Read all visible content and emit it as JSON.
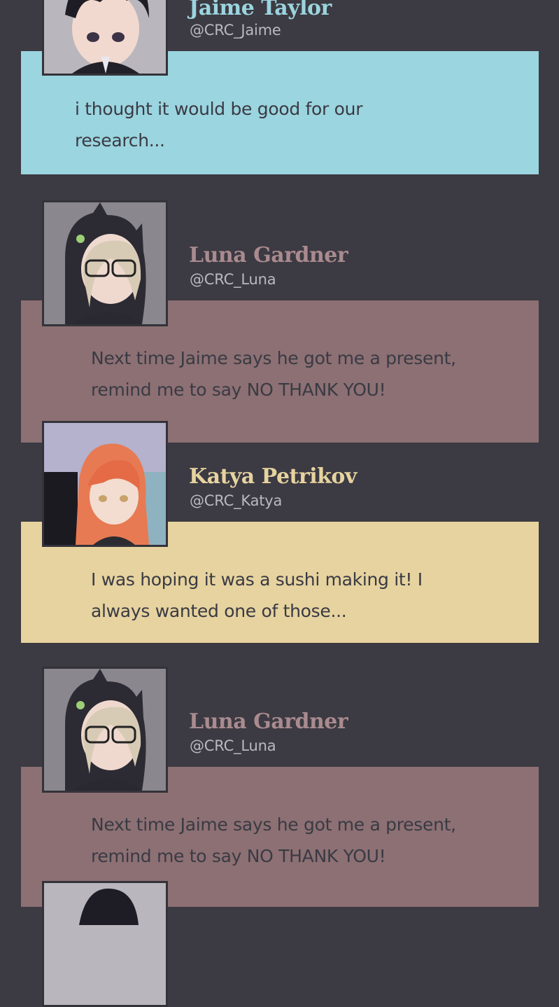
{
  "colors": {
    "background": "#3c3a42",
    "jaime": "#9bd5df",
    "luna": "#8c7073",
    "katya": "#e6d39f",
    "bubble_text": "#3a3a44",
    "luna_name": "#a98b8f",
    "handle": "#b9b9c2"
  },
  "messages": [
    {
      "author": "Jaime Taylor",
      "handle": "@CRC_Jaime",
      "text": "i thought it would be good for our\nresearch...",
      "avatar_icon": "jaime-avatar-icon"
    },
    {
      "author": "Luna Gardner",
      "handle": "@CRC_Luna",
      "text": "Next time Jaime says he got me a present,\nremind me to say NO THANK YOU!",
      "avatar_icon": "luna-avatar-icon"
    },
    {
      "author": "Katya Petrikov",
      "handle": "@CRC_Katya",
      "text": "I was hoping it was a sushi making it! I\nalways wanted one of those...",
      "avatar_icon": "katya-avatar-icon"
    },
    {
      "author": "Luna Gardner",
      "handle": "@CRC_Luna",
      "text": "Next time Jaime says he got me a present,\nremind me to say NO THANK YOU!",
      "avatar_icon": "luna-avatar-icon"
    }
  ]
}
